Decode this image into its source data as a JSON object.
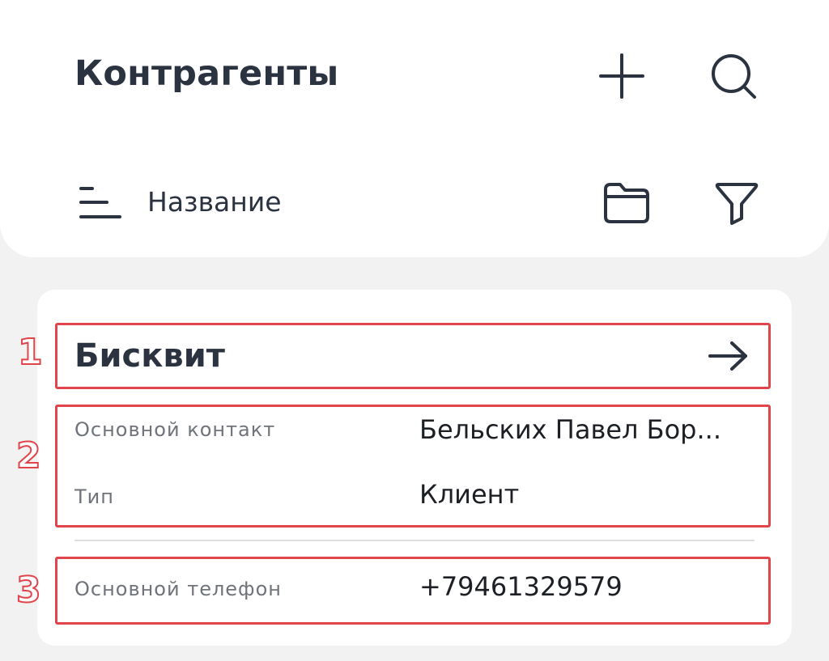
{
  "header": {
    "title": "Контрагенты",
    "add_icon": "plus-icon",
    "search_icon": "search-icon"
  },
  "toolbar": {
    "sort_icon": "sort-lines-icon",
    "sort_label": "Название",
    "folder_icon": "folder-icon",
    "filter_icon": "filter-funnel-icon"
  },
  "card": {
    "name": "Бисквит",
    "open_icon": "arrow-right-icon",
    "fields": [
      {
        "label": "Основной контакт",
        "value": "Бельских Павел Бор..."
      },
      {
        "label": "Тип",
        "value": "Клиент"
      },
      {
        "label": "Основной телефон",
        "value": "+79461329579"
      }
    ]
  },
  "annotations": [
    "1",
    "2",
    "3"
  ],
  "colors": {
    "annotation": "#e0454b",
    "text_dark": "#2b3240",
    "background": "#f2f2f2"
  }
}
